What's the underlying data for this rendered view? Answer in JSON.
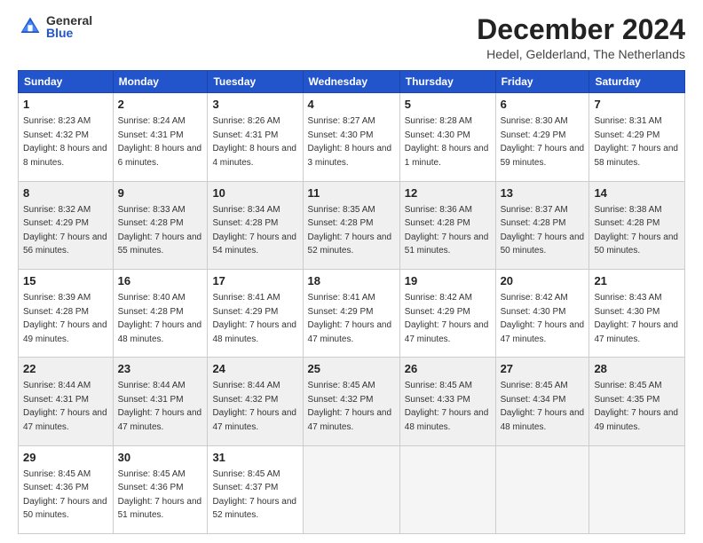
{
  "logo": {
    "general": "General",
    "blue": "Blue"
  },
  "title": "December 2024",
  "subtitle": "Hedel, Gelderland, The Netherlands",
  "days_header": [
    "Sunday",
    "Monday",
    "Tuesday",
    "Wednesday",
    "Thursday",
    "Friday",
    "Saturday"
  ],
  "weeks": [
    [
      {
        "day": "1",
        "sunrise": "8:23 AM",
        "sunset": "4:32 PM",
        "daylight": "8 hours and 8 minutes."
      },
      {
        "day": "2",
        "sunrise": "8:24 AM",
        "sunset": "4:31 PM",
        "daylight": "8 hours and 6 minutes."
      },
      {
        "day": "3",
        "sunrise": "8:26 AM",
        "sunset": "4:31 PM",
        "daylight": "8 hours and 4 minutes."
      },
      {
        "day": "4",
        "sunrise": "8:27 AM",
        "sunset": "4:30 PM",
        "daylight": "8 hours and 3 minutes."
      },
      {
        "day": "5",
        "sunrise": "8:28 AM",
        "sunset": "4:30 PM",
        "daylight": "8 hours and 1 minute."
      },
      {
        "day": "6",
        "sunrise": "8:30 AM",
        "sunset": "4:29 PM",
        "daylight": "7 hours and 59 minutes."
      },
      {
        "day": "7",
        "sunrise": "8:31 AM",
        "sunset": "4:29 PM",
        "daylight": "7 hours and 58 minutes."
      }
    ],
    [
      {
        "day": "8",
        "sunrise": "8:32 AM",
        "sunset": "4:29 PM",
        "daylight": "7 hours and 56 minutes."
      },
      {
        "day": "9",
        "sunrise": "8:33 AM",
        "sunset": "4:28 PM",
        "daylight": "7 hours and 55 minutes."
      },
      {
        "day": "10",
        "sunrise": "8:34 AM",
        "sunset": "4:28 PM",
        "daylight": "7 hours and 54 minutes."
      },
      {
        "day": "11",
        "sunrise": "8:35 AM",
        "sunset": "4:28 PM",
        "daylight": "7 hours and 52 minutes."
      },
      {
        "day": "12",
        "sunrise": "8:36 AM",
        "sunset": "4:28 PM",
        "daylight": "7 hours and 51 minutes."
      },
      {
        "day": "13",
        "sunrise": "8:37 AM",
        "sunset": "4:28 PM",
        "daylight": "7 hours and 50 minutes."
      },
      {
        "day": "14",
        "sunrise": "8:38 AM",
        "sunset": "4:28 PM",
        "daylight": "7 hours and 50 minutes."
      }
    ],
    [
      {
        "day": "15",
        "sunrise": "8:39 AM",
        "sunset": "4:28 PM",
        "daylight": "7 hours and 49 minutes."
      },
      {
        "day": "16",
        "sunrise": "8:40 AM",
        "sunset": "4:28 PM",
        "daylight": "7 hours and 48 minutes."
      },
      {
        "day": "17",
        "sunrise": "8:41 AM",
        "sunset": "4:29 PM",
        "daylight": "7 hours and 48 minutes."
      },
      {
        "day": "18",
        "sunrise": "8:41 AM",
        "sunset": "4:29 PM",
        "daylight": "7 hours and 47 minutes."
      },
      {
        "day": "19",
        "sunrise": "8:42 AM",
        "sunset": "4:29 PM",
        "daylight": "7 hours and 47 minutes."
      },
      {
        "day": "20",
        "sunrise": "8:42 AM",
        "sunset": "4:30 PM",
        "daylight": "7 hours and 47 minutes."
      },
      {
        "day": "21",
        "sunrise": "8:43 AM",
        "sunset": "4:30 PM",
        "daylight": "7 hours and 47 minutes."
      }
    ],
    [
      {
        "day": "22",
        "sunrise": "8:44 AM",
        "sunset": "4:31 PM",
        "daylight": "7 hours and 47 minutes."
      },
      {
        "day": "23",
        "sunrise": "8:44 AM",
        "sunset": "4:31 PM",
        "daylight": "7 hours and 47 minutes."
      },
      {
        "day": "24",
        "sunrise": "8:44 AM",
        "sunset": "4:32 PM",
        "daylight": "7 hours and 47 minutes."
      },
      {
        "day": "25",
        "sunrise": "8:45 AM",
        "sunset": "4:32 PM",
        "daylight": "7 hours and 47 minutes."
      },
      {
        "day": "26",
        "sunrise": "8:45 AM",
        "sunset": "4:33 PM",
        "daylight": "7 hours and 48 minutes."
      },
      {
        "day": "27",
        "sunrise": "8:45 AM",
        "sunset": "4:34 PM",
        "daylight": "7 hours and 48 minutes."
      },
      {
        "day": "28",
        "sunrise": "8:45 AM",
        "sunset": "4:35 PM",
        "daylight": "7 hours and 49 minutes."
      }
    ],
    [
      {
        "day": "29",
        "sunrise": "8:45 AM",
        "sunset": "4:36 PM",
        "daylight": "7 hours and 50 minutes."
      },
      {
        "day": "30",
        "sunrise": "8:45 AM",
        "sunset": "4:36 PM",
        "daylight": "7 hours and 51 minutes."
      },
      {
        "day": "31",
        "sunrise": "8:45 AM",
        "sunset": "4:37 PM",
        "daylight": "7 hours and 52 minutes."
      },
      null,
      null,
      null,
      null
    ]
  ]
}
